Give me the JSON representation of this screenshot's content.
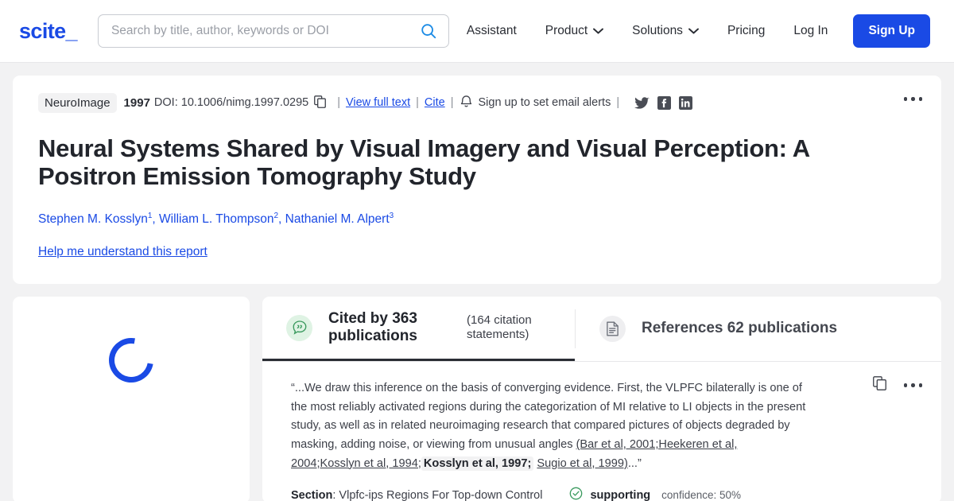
{
  "header": {
    "logo": "scite_",
    "search": {
      "placeholder": "Search by title, author, keywords or DOI",
      "value": ""
    },
    "nav": [
      {
        "label": "Assistant",
        "caret": false
      },
      {
        "label": "Product",
        "caret": true
      },
      {
        "label": "Solutions",
        "caret": true
      },
      {
        "label": "Pricing",
        "caret": false
      },
      {
        "label": "Log In",
        "caret": false
      }
    ],
    "signup_label": "Sign Up"
  },
  "paper": {
    "journal": "NeuroImage",
    "year": "1997",
    "doi": "DOI: 10.1006/nimg.1997.0295",
    "separator": "|",
    "view_full_text": "View full text",
    "cite": "Cite",
    "email_alerts": "Sign up to set email alerts",
    "socials": [
      "twitter-icon",
      "facebook-icon",
      "linkedin-icon"
    ],
    "title": "Neural Systems Shared by Visual Imagery and Visual Perception: A Positron Emission Tomography Study",
    "authors": [
      {
        "name": "Stephen M. Kosslyn",
        "sup": "1"
      },
      {
        "name": "William L. Thompson",
        "sup": "2"
      },
      {
        "name": "Nathaniel M. Alpert",
        "sup": "3"
      }
    ],
    "help_link": "Help me understand this report"
  },
  "tabs": [
    {
      "icon": "quote-bubble-icon",
      "title": "Cited by 363 publications",
      "subtitle": "(164 citation statements)",
      "active": true
    },
    {
      "icon": "document-icon",
      "title": "References 62 publications",
      "subtitle": "",
      "active": false
    }
  ],
  "statement": {
    "text_1": "“...We draw this inference on the basis of converging evidence. First, the VLPFC bilaterally is one of the most reliably activated regions during the categorization of MI relative to LI objects in the present study, as well as in related neuroimaging research that compared pictures of objects degraded by masking, adding noise, or viewing from unusual angles ",
    "refs_a": "(Bar et al, 2001;Heekeren et al, 2004;Kosslyn et al, 1994;",
    "ref_highlight": "Kosslyn et al, 1997;",
    "refs_b": "Sugio et al, 1999)",
    "text_2": "...”",
    "section_label": "Section",
    "section_value": ": Vlpfc-ips Regions For Top-down Control",
    "support_label": "supporting",
    "confidence": "confidence: 50%"
  },
  "colors": {
    "brand_blue": "#1a4ae5",
    "page_bg": "#f2f2f3",
    "text_dark": "#22252c",
    "support_green": "#3a9a5e"
  }
}
